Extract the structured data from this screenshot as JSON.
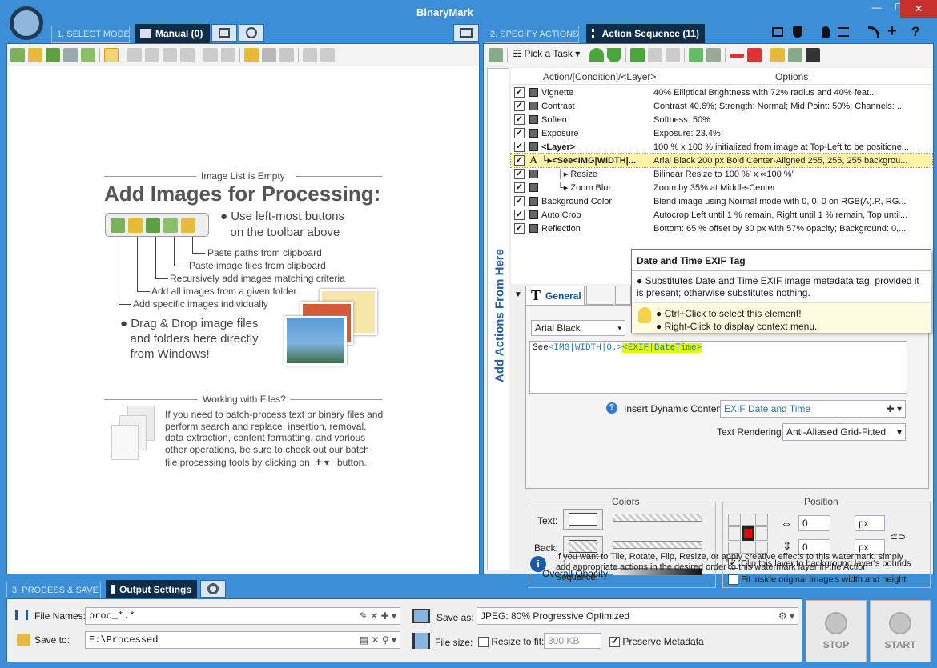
{
  "app_title": "BinaryMark",
  "window": {
    "minimize": "—",
    "maximize": "☐",
    "close": "✕"
  },
  "mode": {
    "step": "1. SELECT MODE",
    "manual_tab": "Manual (0)"
  },
  "actions": {
    "step": "2. SPECIFY ACTIONS",
    "seq_tab": "Action Sequence (11)",
    "pick_task": "Pick a Task",
    "col_action": "Action/[Condition]/<Layer>",
    "col_options": "Options",
    "side_label": "Add Actions From Here",
    "rows": [
      {
        "name": "Vignette",
        "opt": "40% Elliptical Brightness with 72% radius and 40% feat..."
      },
      {
        "name": "Contrast",
        "opt": "Contrast 40.6%; Strength: Normal; Mid Point: 50%; Channels: ..."
      },
      {
        "name": "Soften",
        "opt": "Softness: 50%"
      },
      {
        "name": "Exposure",
        "opt": "Exposure: 23.4%"
      },
      {
        "name": "<Layer>",
        "opt": "100 % x 100 % initialized from image at Top-Left to be positione..."
      },
      {
        "name": "└▸<See<IMG|WIDTH|...",
        "opt": "Arial Black 200 px Bold Center-Aligned 255, 255, 255 backgrou..."
      },
      {
        "name": "├▸ Resize",
        "opt": "Bilinear Resize to 100 %' x ∞100 %'"
      },
      {
        "name": "└▸ Zoom Blur",
        "opt": "Zoom by 35% at Middle-Center"
      },
      {
        "name": "Background Color",
        "opt": "Blend image using Normal mode with 0, 0, 0 on RGB(A).R, RG..."
      },
      {
        "name": "Auto Crop",
        "opt": "Autocrop Left until 1 % remain, Right until 1 % remain, Top until..."
      },
      {
        "name": "Reflection",
        "opt": "Bottom: 65 % offset by 30 px with 57% opacity; Background: 0,..."
      }
    ]
  },
  "tooltip": {
    "title": "Date and Time EXIF Tag",
    "body": "● Substitutes Date and Time EXIF image metadata tag, provided it is present; otherwise substitutes nothing.",
    "tip1": "● Ctrl+Click to select this element!",
    "tip2": "● Right-Click to display context menu."
  },
  "editor": {
    "tab_general": "General",
    "font": "Arial Black",
    "text_a": "See",
    "text_b": "<IMG|WIDTH|0.>",
    "text_c": "<EXIF|DateTime>",
    "insert_label": "Insert Dynamic Content:",
    "insert_value": "EXIF Date and Time",
    "render_label": "Text Rendering:",
    "render_value": "Anti-Aliased Grid-Fitted",
    "colors_title": "Colors",
    "text_label": "Text:",
    "back_label": "Back:",
    "opacity_label": "Overall Opacity:",
    "position_title": "Position",
    "x": "0",
    "y": "0",
    "unit": "px",
    "clip": "Clip this layer to background layer's bounds",
    "fit": "Fit inside original image's width and height",
    "info": "If you want to Tile, Rotate, Flip, Resize, or apply creative effects to this watermark, simply add appropriate actions in the desired order to this watermark layer in the Action Sequence."
  },
  "left": {
    "empty": "Image List is Empty",
    "title": "Add Images for Processing:",
    "use1": "Use left-most buttons",
    "use2": "on the toolbar above",
    "l1": "Paste paths from clipboard",
    "l2": "Paste image files from clipboard",
    "l3": "Recursively add images matching criteria",
    "l4": "Add all images from a given folder",
    "l5": "Add specific images individually",
    "drag1": "Drag & Drop image files",
    "drag2": "and folders here directly",
    "drag3": "from Windows!",
    "files_title": "Working with Files?",
    "files_body": [
      "If you need to batch-process text or binary files and",
      "perform search and replace, insertion, removal,",
      "data extraction, content formatting, and various",
      "other operations, be sure to check out our batch",
      "file processing tools by clicking on",
      "button."
    ]
  },
  "bottom": {
    "step": "3. PROCESS & SAVE",
    "tab": "Output Settings",
    "names_label": "File Names:",
    "names_value": "proc_*.*",
    "save_to_label": "Save to:",
    "save_to_value": "E:\\Processed",
    "save_as_label": "Save as:",
    "save_as_value": "JPEG: 80%  Progressive Optimized",
    "file_size_label": "File size:",
    "resize_label": "Resize to fit:",
    "resize_value": "300 KB",
    "preserve_label": "Preserve Metadata",
    "stop": "STOP",
    "start": "START"
  }
}
